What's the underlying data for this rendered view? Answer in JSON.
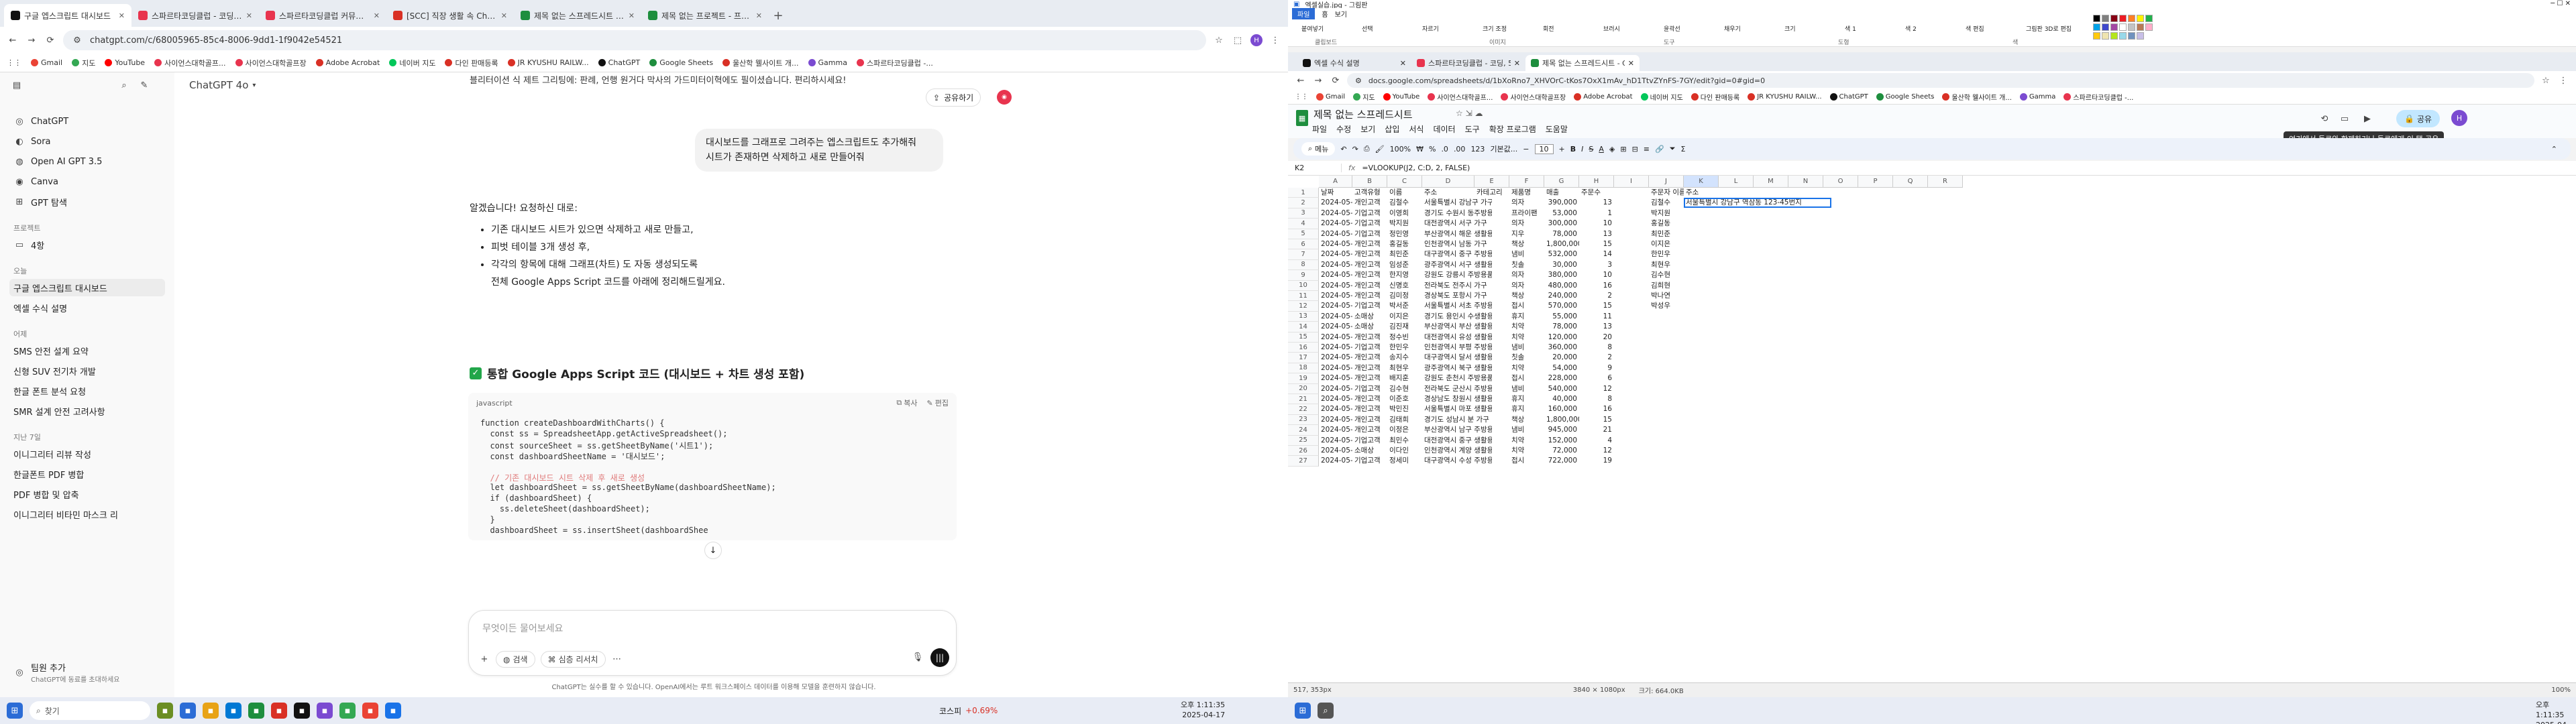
{
  "left": {
    "tabs": [
      {
        "label": "구글 엡스크립트 대시보드",
        "active": true,
        "color": "#111111"
      },
      {
        "label": "스파르타코딩클럽 - 코딩, 5주 완성",
        "active": false,
        "color": "#e8344e"
      },
      {
        "label": "스파르타코딩클럽 커뮤니티 | 모...",
        "active": false,
        "color": "#e8344e"
      },
      {
        "label": "[SCC] 직장 생활 속 ChatGPT 활용...",
        "active": false,
        "color": "#d93025"
      },
      {
        "label": "제목 없는 스프레드시트 - Goo...",
        "active": false,
        "color": "#1e8e3e"
      },
      {
        "label": "제목 없는 프로젝트 - 프로젝트",
        "active": false,
        "color": "#1e8e3e"
      }
    ],
    "url": "chatgpt.com/c/68005965-85c4-8006-9dd1-1f9042e54521",
    "bookmarks": [
      "Gmail",
      "지도",
      "YouTube",
      "사이언스대학골프...",
      "사이언스대학골프장",
      "Adobe Acrobat",
      "네이버 지도",
      "다인 판매등록",
      "JR KYUSHU RAILW...",
      "ChatGPT",
      "Google Sheets",
      "울산학 웰사이트 개...",
      "Gamma",
      "스파르타코딩클럽 -..."
    ],
    "sidebar": {
      "items_top": [
        "ChatGPT",
        "Sora",
        "Open AI GPT 3.5",
        "Canva",
        "GPT 탐색"
      ],
      "project_label": "프로젝트",
      "project_items": [
        "4항"
      ],
      "today_label": "오늘",
      "today_items": [
        "구글 엡스크립트 대시보드",
        "엑셀 수식 설명"
      ],
      "yesterday_label": "어제",
      "yesterday_items": [
        "SMS 안전 설계 요약",
        "신형 SUV 전기차 개발",
        "한글 폰트 분석 요청",
        "SMR 설계 안전 고려사항"
      ],
      "week_label": "지난 7일",
      "week_items": [
        "이니그리터 리뷰 작성",
        "한글폰트 PDF 병합",
        "PDF 병합 및 압축",
        "이니그리터 비타민 마스크 리"
      ],
      "team_add": "팀원 추가",
      "team_sub": "ChatGPT에 동료를 초대하세요"
    },
    "model": "ChatGPT 4o",
    "share": "공유하기",
    "prev_line": "블리터이션 식 제트 그리팅에: 판례, 언행 원거다 막사의 가드미터이혁에도 필이셨습니다. 편리하시세요!",
    "user_bubble_1": "대시보드를 그래프로 그려주는 엡스크립트도 추가해줘",
    "user_bubble_2": "시트가 존재하면 삭제하고 새로 만들어줘",
    "assistant_intro": "알겠습니다! 요청하신 대로:",
    "bullets": [
      "기존 대시보드 시트가 있으면 삭제하고 새로 만들고,",
      "피벗 테이블 3개 생성 후,",
      "각각의 항목에 대해 그래프(차트) 도 자동 생성되도록",
      "전체 Google Apps Script 코드를 아래에 정리해드릴게요."
    ],
    "heading": "통합 Google Apps Script 코드 (대시보드 + 차트 생성 포함)",
    "code_lang": "javascript",
    "code_copy": "복사",
    "code_edit": "편집",
    "code_lines": [
      "function createDashboardWithCharts() {",
      "  const ss = SpreadsheetApp.getActiveSpreadsheet();",
      "  const sourceSheet = ss.getSheetByName('시트1');",
      "  const dashboardSheetName = '대시보드';",
      "",
      "  // 기존 대시보드 시트 삭제 후 새로 생성",
      "  let dashboardSheet = ss.getSheetByName(dashboardSheetName);",
      "  if (dashboardSheet) {",
      "    ss.deleteSheet(dashboardSheet);",
      "  }",
      "  dashboardSheet = ss.insertSheet(dashboardShee"
    ],
    "composer_placeholder": "무엇이든 물어보세요",
    "composer_search": "검색",
    "composer_research": "심층 리서치",
    "disclaimer": "ChatGPT는 실수를 할 수 있습니다. OpenAI에서는 루트 워크스페이스 데이터를 이용해 모델을 훈련하지 않습니다.",
    "taskbar": {
      "search": "찾기",
      "stock_name": "코스피",
      "stock_change": "+0.69%",
      "time": "오후 1:11:35",
      "date": "2025-04-17"
    }
  },
  "right": {
    "paint": {
      "title": "엑셀실습.jpg - 그림판",
      "menu_file": "파일",
      "menu_home": "홈",
      "menu_view": "보기",
      "groups": [
        "클립보드",
        "이미지",
        "도구",
        "도형",
        "색"
      ],
      "labels": [
        "붙여넣기",
        "선택",
        "자르기",
        "크기 조정",
        "회전",
        "브러시",
        "윤곽선",
        "채우기",
        "크기",
        "색 1",
        "색 2",
        "색 편집",
        "그림판 3D로 편집"
      ],
      "colors": [
        "#000000",
        "#7f7f7f",
        "#880015",
        "#ed1c24",
        "#ff7f27",
        "#fff200",
        "#22b14c",
        "#00a2e8",
        "#3f48cc",
        "#a349a4",
        "#ffffff",
        "#c3c3c3",
        "#b97a57",
        "#ffaec9",
        "#ffc90e",
        "#efe4b0",
        "#b5e61d",
        "#99d9ea",
        "#7092be",
        "#c8bfe7"
      ]
    },
    "tabs": [
      {
        "label": "엑셀 수식 설명",
        "active": false,
        "color": "#111111"
      },
      {
        "label": "스파르타코딩클럽 - 코딩, 5주 완성",
        "active": false,
        "color": "#e8344e"
      },
      {
        "label": "제목 없는 스프레드시트 - Goo...",
        "active": true,
        "color": "#1e8e3e"
      }
    ],
    "url": "docs.google.com/spreadsheets/d/1bXoRno7_XHVOrC-tKos7OxX1mAv_hD1TtvZYnFS-7GY/edit?gid=0#gid=0",
    "bookmarks": [
      "Gmail",
      "지도",
      "YouTube",
      "사이언스대학골프...",
      "사이언스대학골프장",
      "Adobe Acrobat",
      "네이버 지도",
      "다인 판매등록",
      "JR KYUSHU RAILW...",
      "ChatGPT",
      "Google Sheets",
      "울산학 웰사이트 개...",
      "Gamma",
      "스파르타코딩클럽 -..."
    ],
    "sheet": {
      "title": "제목 없는 스프레드시트",
      "menus": [
        "파일",
        "수정",
        "보기",
        "삽입",
        "서식",
        "데이터",
        "도구",
        "확장 프로그램",
        "도움말"
      ],
      "share": "공유",
      "tooltip": "여기에서 동료와 함께하거나 동료에게 이 탭 공유",
      "search": "메뉴",
      "zoom": "100%",
      "currency": "₩",
      "percent": "%",
      "dec1": ".0",
      "dec2": ".00",
      "fmt123": "123",
      "font": "기본값...",
      "size": "10",
      "cellref": "K2",
      "formula": "=VLOOKUP(J2, C:D, 2, FALSE)",
      "cols": [
        "A",
        "B",
        "C",
        "D",
        "E",
        "F",
        "G",
        "H",
        "I",
        "J",
        "K",
        "L",
        "M",
        "N",
        "O",
        "P",
        "Q",
        "R"
      ],
      "headers": [
        "날짜",
        "고객유형",
        "이름",
        "주소",
        "카테고리",
        "제품명",
        "매출",
        "주문수",
        "",
        "주문자 이름",
        "주소"
      ],
      "rows": [
        [
          "2024-05-01",
          "개인고객",
          "김철수",
          "서울특별시 강남구 가구",
          "의자",
          "390,000",
          "13"
        ],
        [
          "2024-05-01",
          "기업고객",
          "이영희",
          "경기도 수원시 동주방용품",
          "프라이팬",
          "53,000",
          "1"
        ],
        [
          "2024-05-01",
          "기업고객",
          "박지원",
          "대전광역시 서구 가구",
          "의자",
          "300,000",
          "10"
        ],
        [
          "2024-05-01",
          "기업고객",
          "정민영",
          "부산광역시 해운 생활용품",
          "지우",
          "78,000",
          "13"
        ],
        [
          "2024-05-01",
          "개인고객",
          "홍길동",
          "인천광역시 남동 가구",
          "책상",
          "1,800,000",
          "15"
        ],
        [
          "2024-05-01",
          "개인고객",
          "최민준",
          "대구광역시 중구 주방용품",
          "냄비",
          "532,000",
          "14"
        ],
        [
          "2024-05-01",
          "개인고객",
          "임성준",
          "광주광역시 서구 생활용품",
          "칫솔",
          "30,000",
          "3"
        ],
        [
          "2024-05-01",
          "개인고객",
          "한지영",
          "강원도 강릉시 주방용품",
          "의자",
          "380,000",
          "10"
        ],
        [
          "2024-05-02",
          "개인고객",
          "신명호",
          "전라북도 전주시 가구",
          "의자",
          "480,000",
          "16"
        ],
        [
          "2024-05-02",
          "개인고객",
          "김미정",
          "경상북도 포항시 가구",
          "책상",
          "240,000",
          "2"
        ],
        [
          "2024-05-02",
          "기업고객",
          "박서준",
          "서울특별시 서초 주방용품",
          "접시",
          "570,000",
          "15"
        ],
        [
          "2024-05-02",
          "소매상",
          "이지은",
          "경기도 용인시 수생활용품",
          "휴지",
          "55,000",
          "11"
        ],
        [
          "2024-05-02",
          "소매상",
          "김진재",
          "부산광역시 부산 생활용품",
          "치약",
          "78,000",
          "13"
        ],
        [
          "2024-05-02",
          "개인고객",
          "정수빈",
          "대전광역시 유성 생활용품",
          "치약",
          "120,000",
          "20"
        ],
        [
          "2024-05-02",
          "기업고객",
          "한민우",
          "인천광역시 부평 주방용품",
          "냄비",
          "360,000",
          "8"
        ],
        [
          "2024-05-03",
          "개인고객",
          "송지수",
          "대구광역시 달서 생활용품",
          "칫솔",
          "20,000",
          "2"
        ],
        [
          "2024-05-03",
          "개인고객",
          "최현우",
          "광주광역시 북구 생활용품",
          "치약",
          "54,000",
          "9"
        ],
        [
          "2024-05-03",
          "개인고객",
          "배지훈",
          "강원도 춘천시 주방용품",
          "접시",
          "228,000",
          "6"
        ],
        [
          "2024-05-03",
          "기업고객",
          "김수현",
          "전라북도 군산시 주방용품",
          "냄비",
          "540,000",
          "12"
        ],
        [
          "2024-05-03",
          "개인고객",
          "이준호",
          "경상남도 창원시 생활용품",
          "휴지",
          "40,000",
          "8"
        ],
        [
          "2024-05-03",
          "개인고객",
          "박민진",
          "서울특별시 마포 생활용품",
          "휴지",
          "160,000",
          "16"
        ],
        [
          "2024-05-03",
          "개인고객",
          "김태희",
          "경기도 성남시 분 가구",
          "책상",
          "1,800,000",
          "15"
        ],
        [
          "2024-05-03",
          "개인고객",
          "이정은",
          "부산광역시 남구 주방용품",
          "냄비",
          "945,000",
          "21"
        ],
        [
          "2024-05-03",
          "기업고객",
          "최민수",
          "대전광역시 중구 생활용품",
          "치약",
          "152,000",
          "4"
        ],
        [
          "2024-05-04",
          "소매상",
          "이다인",
          "인천광역시 계양 생활용품",
          "치약",
          "72,000",
          "12"
        ],
        [
          "2024-05-04",
          "기업고객",
          "정세미",
          "대구광역시 수성 주방용품",
          "접시",
          "722,000",
          "19"
        ]
      ],
      "j_names": [
        "김철수",
        "박지원",
        "홍길동",
        "최민준",
        "이지은",
        "한민우",
        "최현우",
        "김수현",
        "김희현",
        "박나연",
        "박성우"
      ],
      "k2_value": "서울특별시 강남구 역삼동 123-45번지",
      "status_left": "517, 353px",
      "status_mid": "3840 × 1080px",
      "status_size": "크기: 664.0KB",
      "status_zoom": "100%"
    },
    "taskbar": {
      "time": "오후 1:11:35",
      "date": "2025-04-17"
    }
  }
}
